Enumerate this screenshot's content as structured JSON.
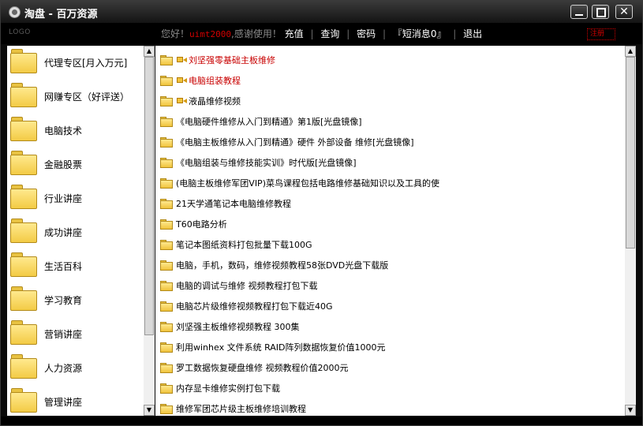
{
  "window": {
    "title": "淘盘 - 百万资源"
  },
  "toolbar": {
    "logo": "LOGO",
    "greeting": "您好！",
    "username": "uimt2000",
    "thanks": ",感谢使用！",
    "links": [
      "充值",
      "查询",
      "密码",
      "『短消息0』",
      "退出"
    ],
    "separator": "|",
    "badge": "注册"
  },
  "sidebar": {
    "items": [
      {
        "label": "代理专区[月入万元]"
      },
      {
        "label": "网赚专区（好评送）"
      },
      {
        "label": "电脑技术"
      },
      {
        "label": "金融股票"
      },
      {
        "label": "行业讲座"
      },
      {
        "label": "成功讲座"
      },
      {
        "label": "生活百科"
      },
      {
        "label": "学习教育"
      },
      {
        "label": "营销讲座"
      },
      {
        "label": "人力资源"
      },
      {
        "label": "管理讲座"
      }
    ]
  },
  "main": {
    "items": [
      {
        "label": "刘坚强零基础主板维修",
        "video": true,
        "highlight": true
      },
      {
        "label": "电脑组装教程",
        "video": true,
        "highlight": true
      },
      {
        "label": "液晶维修视频",
        "video": true,
        "highlight": false
      },
      {
        "label": "《电脑硬件维修从入门到精通》第1版[光盘镜像]",
        "video": false,
        "highlight": false
      },
      {
        "label": "《电脑主板维修从入门到精通》硬件 外部设备 维修[光盘镜像]",
        "video": false,
        "highlight": false
      },
      {
        "label": "《电脑组装与维修技能实训》时代版[光盘镜像]",
        "video": false,
        "highlight": false
      },
      {
        "label": "(电脑主板维修军团VIP)菜鸟课程包括电路维修基础知识以及工具的使",
        "video": false,
        "highlight": false
      },
      {
        "label": "21天学通笔记本电脑维修教程",
        "video": false,
        "highlight": false
      },
      {
        "label": "T60电路分析",
        "video": false,
        "highlight": false
      },
      {
        "label": "笔记本图纸资料打包批量下载100G",
        "video": false,
        "highlight": false
      },
      {
        "label": "电脑，手机，数码，维修视频教程58张DVD光盘下载版",
        "video": false,
        "highlight": false
      },
      {
        "label": "电脑的调试与维修 视频教程打包下载",
        "video": false,
        "highlight": false
      },
      {
        "label": "电脑芯片级维修视频教程打包下载近40G",
        "video": false,
        "highlight": false
      },
      {
        "label": "刘坚强主板维修视频教程 300集",
        "video": false,
        "highlight": false
      },
      {
        "label": "利用winhex 文件系统 RAID阵列数据恢复价值1000元",
        "video": false,
        "highlight": false
      },
      {
        "label": "罗工数据恢复硬盘维修 视频教程价值2000元",
        "video": false,
        "highlight": false
      },
      {
        "label": "内存显卡维修实例打包下载",
        "video": false,
        "highlight": false
      },
      {
        "label": "维修军团芯片级主板维修培训教程",
        "video": false,
        "highlight": false
      }
    ]
  },
  "scrollbars": {
    "left": {
      "arrow_up": "▲",
      "arrow_down": "▼",
      "position": 0.0,
      "visible_fraction": 0.8
    },
    "right": {
      "arrow_up": "▲",
      "arrow_down": "▼",
      "position": 0.0,
      "visible_fraction": 0.55
    }
  },
  "colors": {
    "accent_red": "#c80000",
    "folder_yellow": "#f3cb45",
    "chrome_dark": "#0a0a0a"
  }
}
